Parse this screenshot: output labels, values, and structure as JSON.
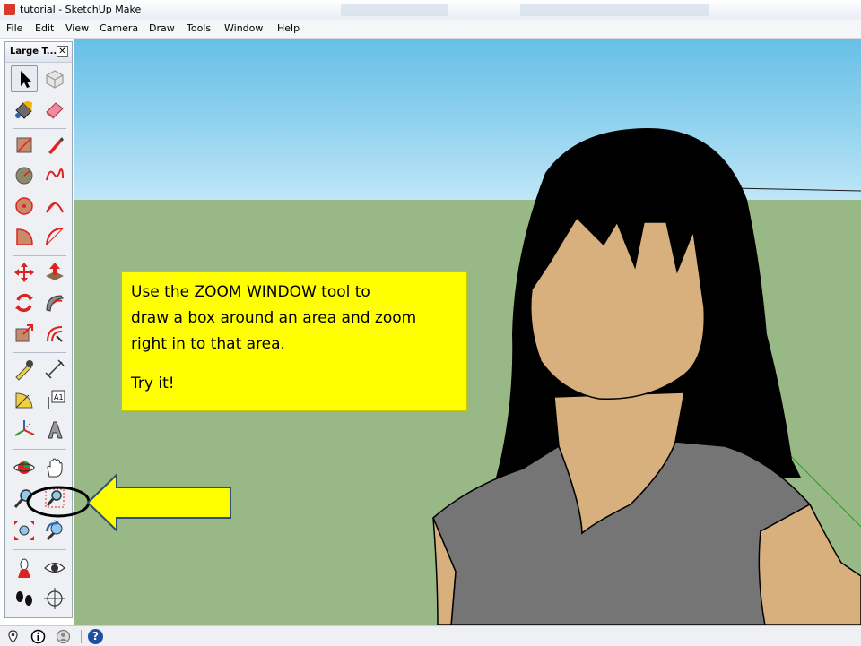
{
  "window": {
    "title": "tutorial - SketchUp Make"
  },
  "menubar": {
    "items": [
      "File",
      "Edit",
      "View",
      "Camera",
      "Draw",
      "Tools",
      "Window",
      "Help"
    ]
  },
  "toolbar": {
    "title": "Large T...",
    "close_label": "✕",
    "tools": [
      {
        "name": "select-icon",
        "selected": true
      },
      {
        "name": "make-component-icon"
      },
      {
        "name": "paint-bucket-icon"
      },
      {
        "name": "eraser-icon"
      },
      {
        "name": "rectangle-icon"
      },
      {
        "name": "line-icon"
      },
      {
        "name": "circle-icon"
      },
      {
        "name": "freehand-icon"
      },
      {
        "name": "polygon-icon"
      },
      {
        "name": "arc-icon"
      },
      {
        "name": "pie-icon"
      },
      {
        "name": "two-point-arc-icon"
      },
      {
        "name": "move-icon"
      },
      {
        "name": "push-pull-icon"
      },
      {
        "name": "rotate-icon"
      },
      {
        "name": "follow-me-icon"
      },
      {
        "name": "scale-icon"
      },
      {
        "name": "offset-icon"
      },
      {
        "name": "tape-measure-icon"
      },
      {
        "name": "dimensions-icon"
      },
      {
        "name": "protractor-icon"
      },
      {
        "name": "text-icon"
      },
      {
        "name": "axes-icon"
      },
      {
        "name": "3d-text-icon"
      },
      {
        "name": "orbit-icon"
      },
      {
        "name": "pan-icon"
      },
      {
        "name": "zoom-icon"
      },
      {
        "name": "zoom-window-icon",
        "highlighted": true
      },
      {
        "name": "zoom-extents-icon"
      },
      {
        "name": "previous-view-icon"
      },
      {
        "name": "position-camera-icon"
      },
      {
        "name": "look-around-icon"
      },
      {
        "name": "walk-icon"
      },
      {
        "name": "section-plane-icon"
      }
    ],
    "text_tool_label": "A1"
  },
  "callout": {
    "line1": "Use the ZOOM WINDOW tool to",
    "line2": "draw a box around an area and zoom",
    "line3": "right in to that area.",
    "line4": "Try it!"
  },
  "statusbar": {
    "icons": [
      "geo-location-icon",
      "credits-icon",
      "user-icon",
      "help-icon"
    ],
    "help_label": "?"
  },
  "colors": {
    "sky": "#7cc9ea",
    "ground": "#98b886",
    "callout": "#ffff00",
    "arrow": "#ffff00",
    "arrow_border": "#2f4f73",
    "hair": "#000000",
    "skin": "#d8b07e",
    "shirt": "#757575"
  }
}
